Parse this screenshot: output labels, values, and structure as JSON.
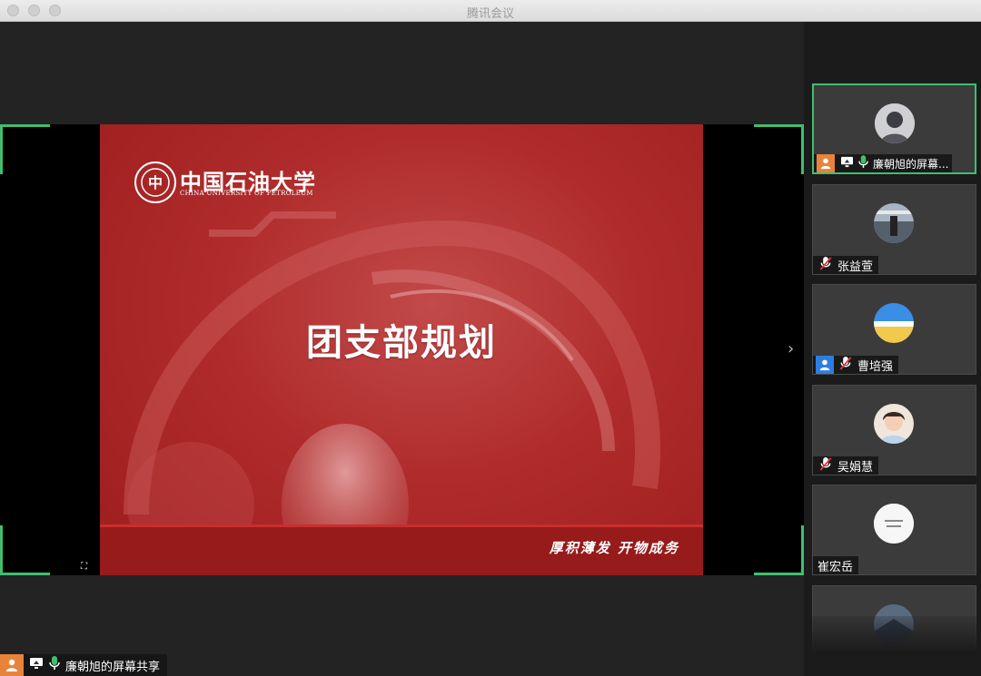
{
  "window": {
    "title": "腾讯会议"
  },
  "slide": {
    "title": "团支部规划",
    "logo_cn": "中国石油大学",
    "logo_en": "CHINA UNIVERSITY OF PETROLEUM",
    "motto": "厚积薄发  开物成务"
  },
  "presenter_tag": {
    "label": "廉朝旭的屏幕共享"
  },
  "participants": [
    {
      "name": "廉朝旭的屏幕...",
      "mic": "on",
      "sharing": true,
      "host": true
    },
    {
      "name": "张益萱",
      "mic": "muted"
    },
    {
      "name": "曹培强",
      "mic": "muted",
      "host": true
    },
    {
      "name": "吴娟慧",
      "mic": "muted"
    },
    {
      "name": "崔宏岳",
      "mic": "none"
    }
  ],
  "colors": {
    "accent": "#3fbf6f",
    "slide_red": "#b02c2c",
    "host_orange": "#e8833a",
    "host_blue": "#2f7de1"
  }
}
